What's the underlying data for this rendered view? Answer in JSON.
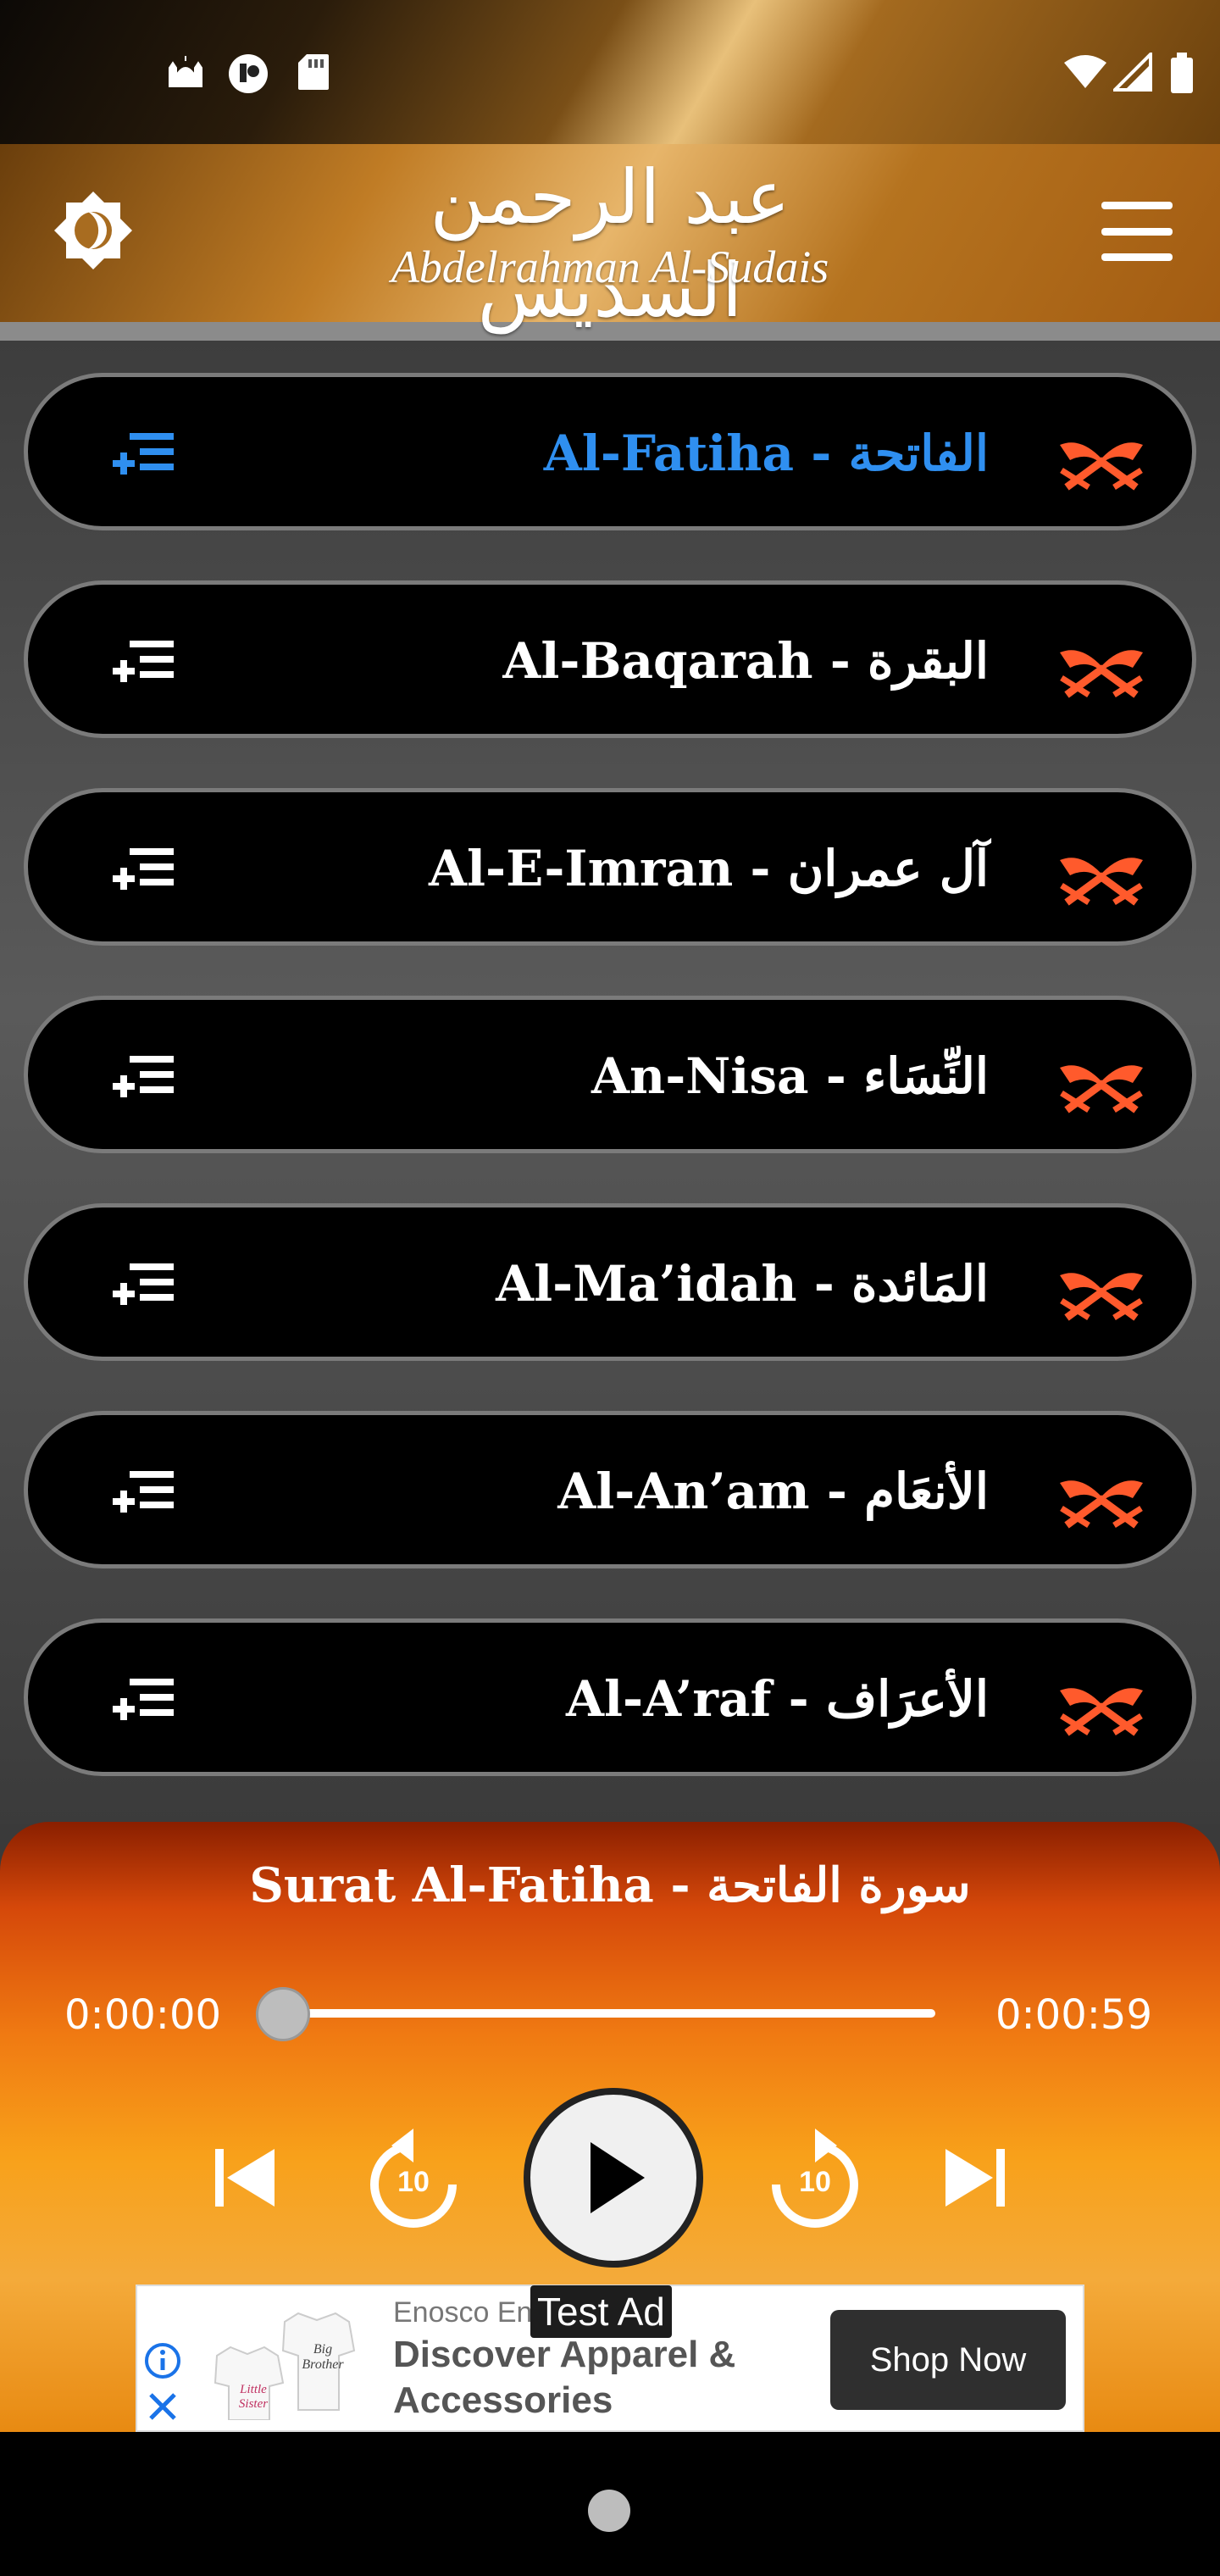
{
  "app": {
    "title_arabic": "عبد الرحمن السديس",
    "title_latin": "Abdelrahman Al-Sudais"
  },
  "status_bar": {
    "left_icons": [
      "mosque-icon",
      "app-notification-icon",
      "sd-card-icon"
    ],
    "right_icons": [
      "wifi-icon",
      "signal-icon",
      "battery-icon"
    ]
  },
  "header": {
    "theme_icon": "brightness-icon",
    "menu_icon": "hamburger-menu-icon"
  },
  "surahs": [
    {
      "label": "Al-Fatiha - الفاتحة",
      "active": true
    },
    {
      "label": "Al-Baqarah - البقرة",
      "active": false
    },
    {
      "label": "Al-E-Imran - آل عمران",
      "active": false
    },
    {
      "label": "An-Nisa - النِّسَاء",
      "active": false
    },
    {
      "label": "Al-Ma’idah - المَائدة",
      "active": false
    },
    {
      "label": "Al-An’am - الأنعَام",
      "active": false
    },
    {
      "label": "Al-A’raf - الأعرَاف",
      "active": false
    }
  ],
  "player": {
    "now_playing": "Surat Al-Fatiha - سورة الفاتحة",
    "current_time": "0:00:00",
    "total_time": "0:00:59",
    "progress": 0.0,
    "rewind_seconds": "10",
    "forward_seconds": "10"
  },
  "ad": {
    "label": "Test Ad",
    "advertiser": "Enosco En",
    "headline": "Discover Apparel & Accessories",
    "cta": "Shop Now",
    "image_text_1": "Big Brother",
    "image_text_2": "Little Sister"
  },
  "colors": {
    "active_item": "#2f8ff0",
    "quran_icon": "#ff5a2c",
    "row_background": "#000000"
  }
}
